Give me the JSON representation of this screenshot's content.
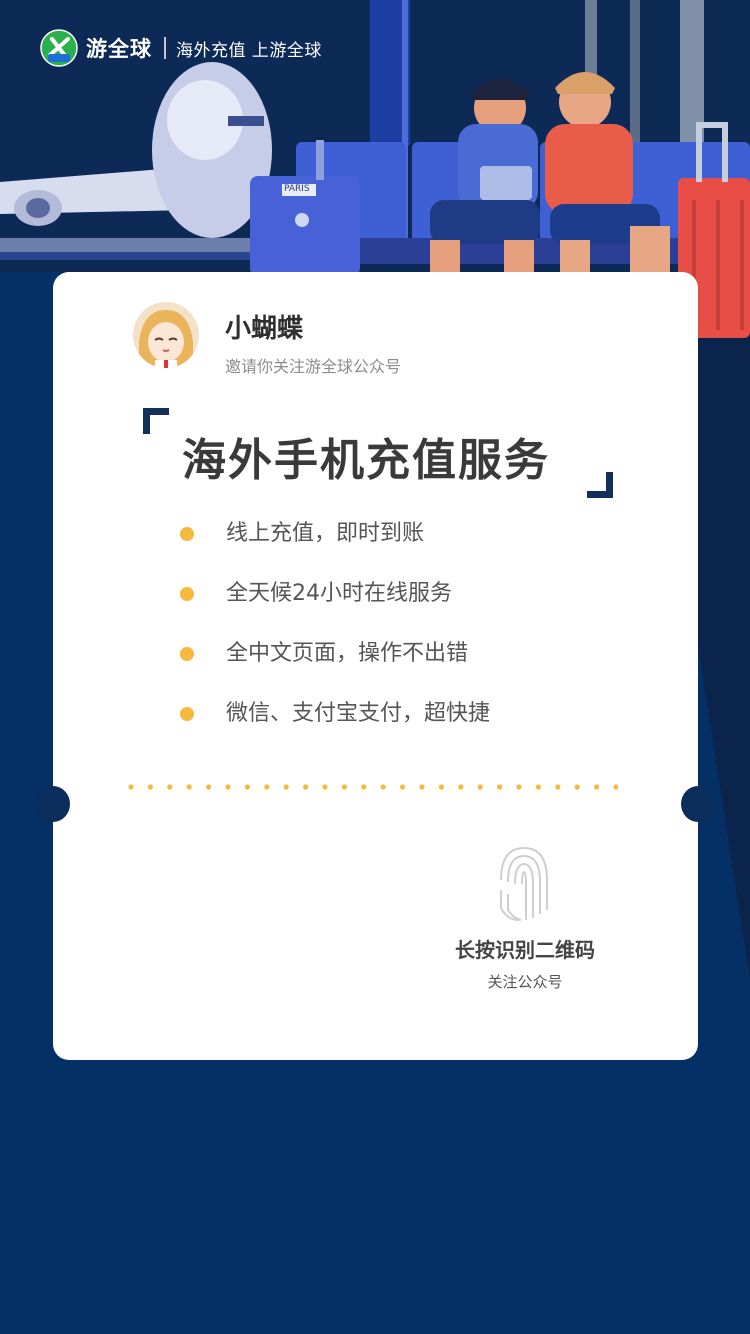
{
  "header": {
    "brand_name": "游全球",
    "slogan": "海外充值 上游全球"
  },
  "card": {
    "user_name": "小蝴蝶",
    "invite_text": "邀请你关注游全球公众号",
    "headline": "海外手机充值服务",
    "features": [
      {
        "label": "线上充值，即时到账"
      },
      {
        "label": "全天候24小时在线服务"
      },
      {
        "label": "全中文页面，操作不出错"
      },
      {
        "label": "微信、支付宝支付，超快捷"
      }
    ],
    "qr": {
      "label": "长按识别二维码",
      "sublabel": "关注公众号"
    }
  },
  "illustration": {
    "luggage_tag": "PARIS"
  },
  "colors": {
    "background": "#053066",
    "accent_dot": "#f5b93e",
    "bracket": "#13305a"
  }
}
